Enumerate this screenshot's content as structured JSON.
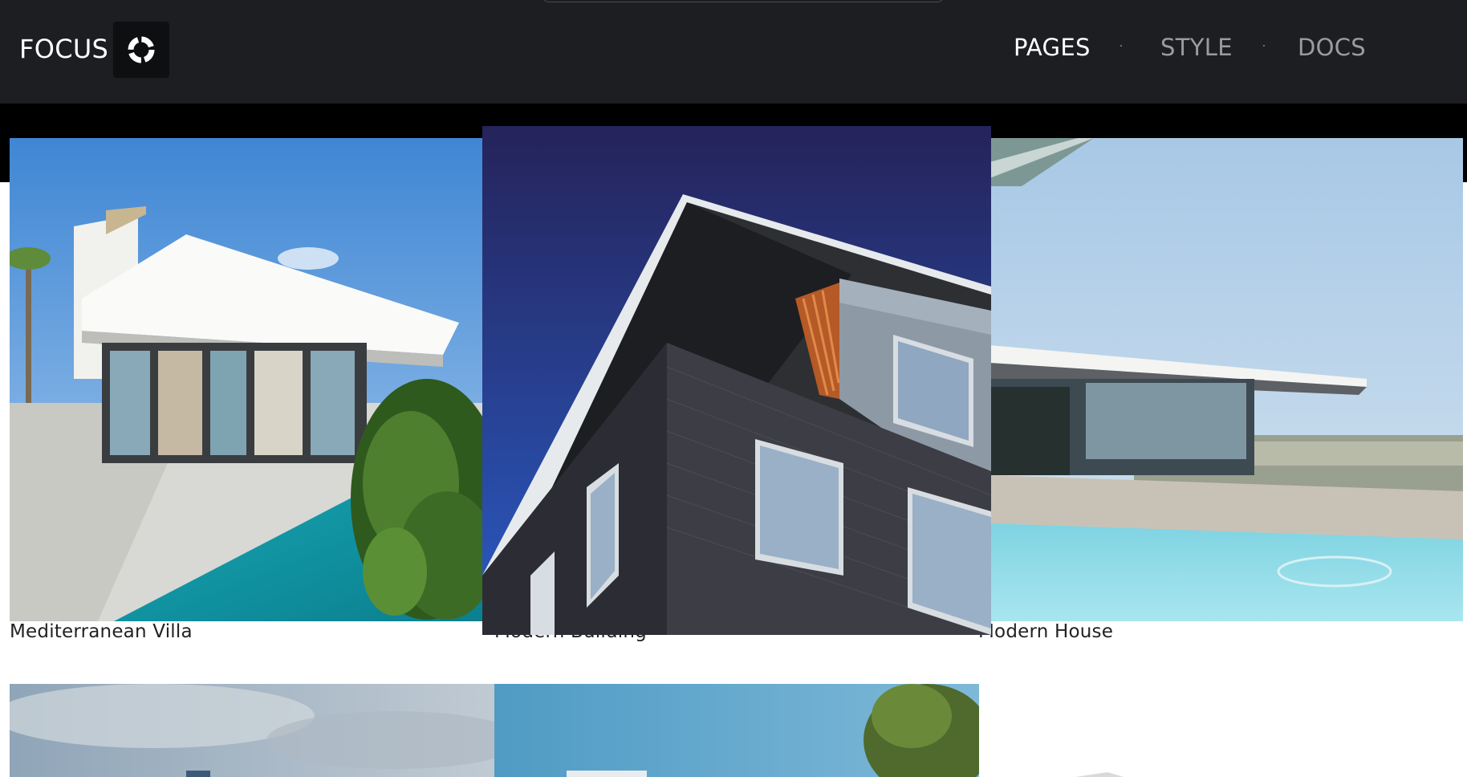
{
  "header": {
    "brand": "FOCUS",
    "logo_icon": "ring-logo-icon",
    "nav": [
      "PAGES",
      "STYLE",
      "DOCS"
    ],
    "active_nav": "PAGES"
  },
  "gallery": {
    "items": [
      {
        "caption": "Mediterranean Villa"
      },
      {
        "caption": "Modern Building"
      },
      {
        "caption": "Modern House"
      }
    ]
  },
  "colors": {
    "header_bg": "#1c1e21",
    "nav_active": "#ffffff",
    "nav_inactive": "#9a9ca0"
  }
}
